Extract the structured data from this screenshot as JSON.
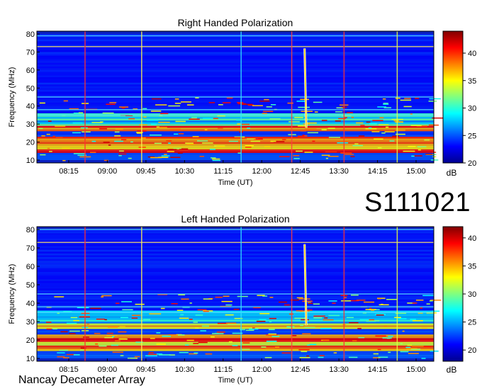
{
  "observation_id": "S111021",
  "instrument": "Nancay Decameter Array",
  "chart_data": [
    {
      "type": "heatmap",
      "title": "Right Handed Polarization",
      "xlabel": "Time (UT)",
      "ylabel": "Frequency (MHz)",
      "x_tick_labels": [
        "08:15",
        "09:00",
        "09:45",
        "10:30",
        "11:15",
        "12:00",
        "12:45",
        "13:30",
        "14:15",
        "15:00"
      ],
      "y_tick_labels": [
        "10",
        "20",
        "30",
        "40",
        "50",
        "60",
        "70",
        "80"
      ],
      "ylim": [
        10,
        80
      ],
      "colorbar": {
        "unit": "dB",
        "range": [
          20,
          44
        ],
        "tick_labels": [
          "20",
          "25",
          "30",
          "35",
          "40"
        ]
      },
      "features": {
        "bright_lanes_MHz": [
          [
            14,
            23
          ],
          [
            26,
            29
          ]
        ],
        "interference_lines_MHz": [
          73,
          79,
          45,
          38,
          35
        ],
        "type_II_burst": {
          "start_time": "12:50",
          "start_freq_MHz": 72,
          "end_time": "12:52",
          "end_freq_MHz": 28
        },
        "vertical_lines_time": [
          "08:34",
          "09:40",
          "11:36",
          "12:35",
          "13:36",
          "14:38"
        ]
      }
    },
    {
      "type": "heatmap",
      "title": "Left Handed Polarization",
      "xlabel": "Time (UT)",
      "ylabel": "Frequency (MHz)",
      "x_tick_labels": [
        "08:15",
        "09:00",
        "09:45",
        "10:30",
        "11:15",
        "12:00",
        "12:45",
        "13:30",
        "14:15",
        "15:00"
      ],
      "y_tick_labels": [
        "10",
        "20",
        "30",
        "40",
        "50",
        "60",
        "70",
        "80"
      ],
      "ylim": [
        10,
        80
      ],
      "colorbar": {
        "unit": "dB",
        "range": [
          18,
          42
        ],
        "tick_labels": [
          "20",
          "25",
          "30",
          "35",
          "40"
        ]
      },
      "features": {
        "bright_lanes_MHz": [
          [
            14,
            23
          ],
          [
            26,
            29
          ]
        ],
        "interference_lines_MHz": [
          73,
          80,
          45,
          38,
          35
        ],
        "type_II_burst": {
          "start_time": "12:50",
          "start_freq_MHz": 72,
          "end_time": "12:52",
          "end_freq_MHz": 28
        },
        "vertical_lines_time": [
          "08:34",
          "09:40",
          "11:36",
          "12:35",
          "13:36",
          "14:38"
        ]
      }
    }
  ]
}
